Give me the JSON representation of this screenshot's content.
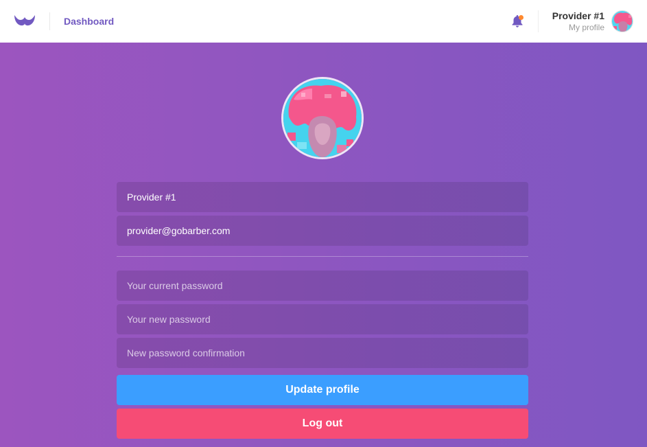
{
  "header": {
    "nav_label": "Dashboard",
    "logo_icon": "mustache-logo-icon",
    "bell_icon": "bell-icon",
    "notification_dot_color": "#ff892e",
    "profile_name": "Provider #1",
    "profile_link": "My profile"
  },
  "profile_form": {
    "name_value": "Provider #1",
    "email_value": "provider@gobarber.com",
    "old_password_placeholder": "Your current password",
    "new_password_placeholder": "Your new password",
    "confirm_password_placeholder": "New password confirmation",
    "update_label": "Update profile",
    "logout_label": "Log out"
  },
  "colors": {
    "brand": "#7159c1",
    "update_button": "#3b9eff",
    "logout_button": "#f64c75",
    "background_start": "#9c55bf",
    "background_end": "#7f57c2"
  }
}
